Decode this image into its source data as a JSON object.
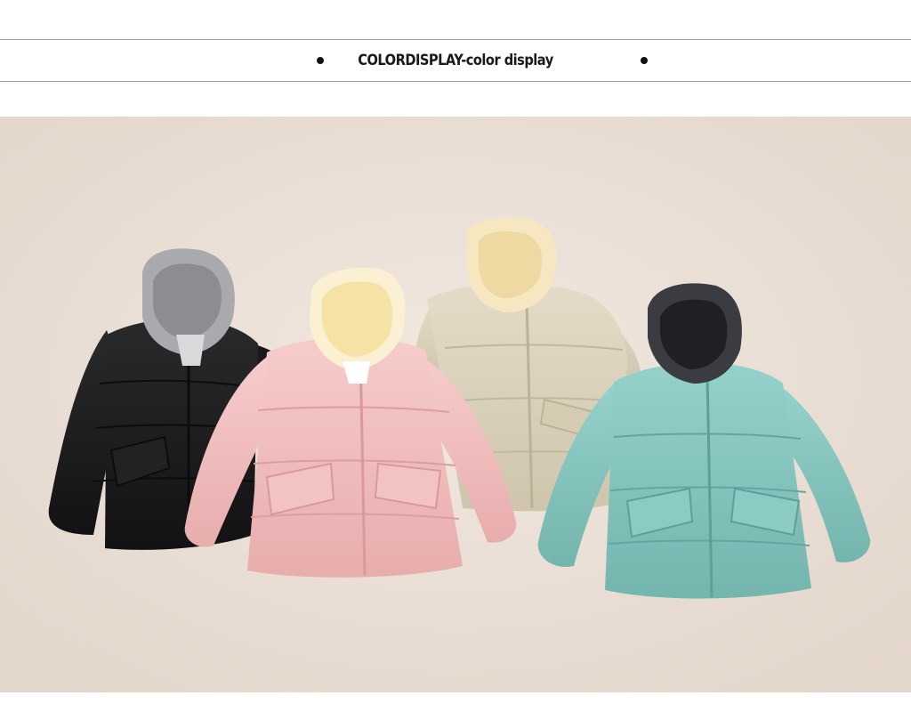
{
  "header": {
    "title": "COLORDISPLAY-color display"
  },
  "photo": {
    "background_color": "#ece1d8",
    "items": [
      {
        "name": "black-jacket",
        "body_color": "#1b1b1d",
        "hood_color": "#8e8f92"
      },
      {
        "name": "pink-jacket",
        "body_color": "#f0bcbc",
        "hood_color": "#f7e2a6"
      },
      {
        "name": "beige-jacket",
        "body_color": "#dcd3bd",
        "hood_color": "#f6e7c1"
      },
      {
        "name": "mint-jacket",
        "body_color": "#86c7c0",
        "hood_color": "#2b2d31"
      }
    ]
  }
}
